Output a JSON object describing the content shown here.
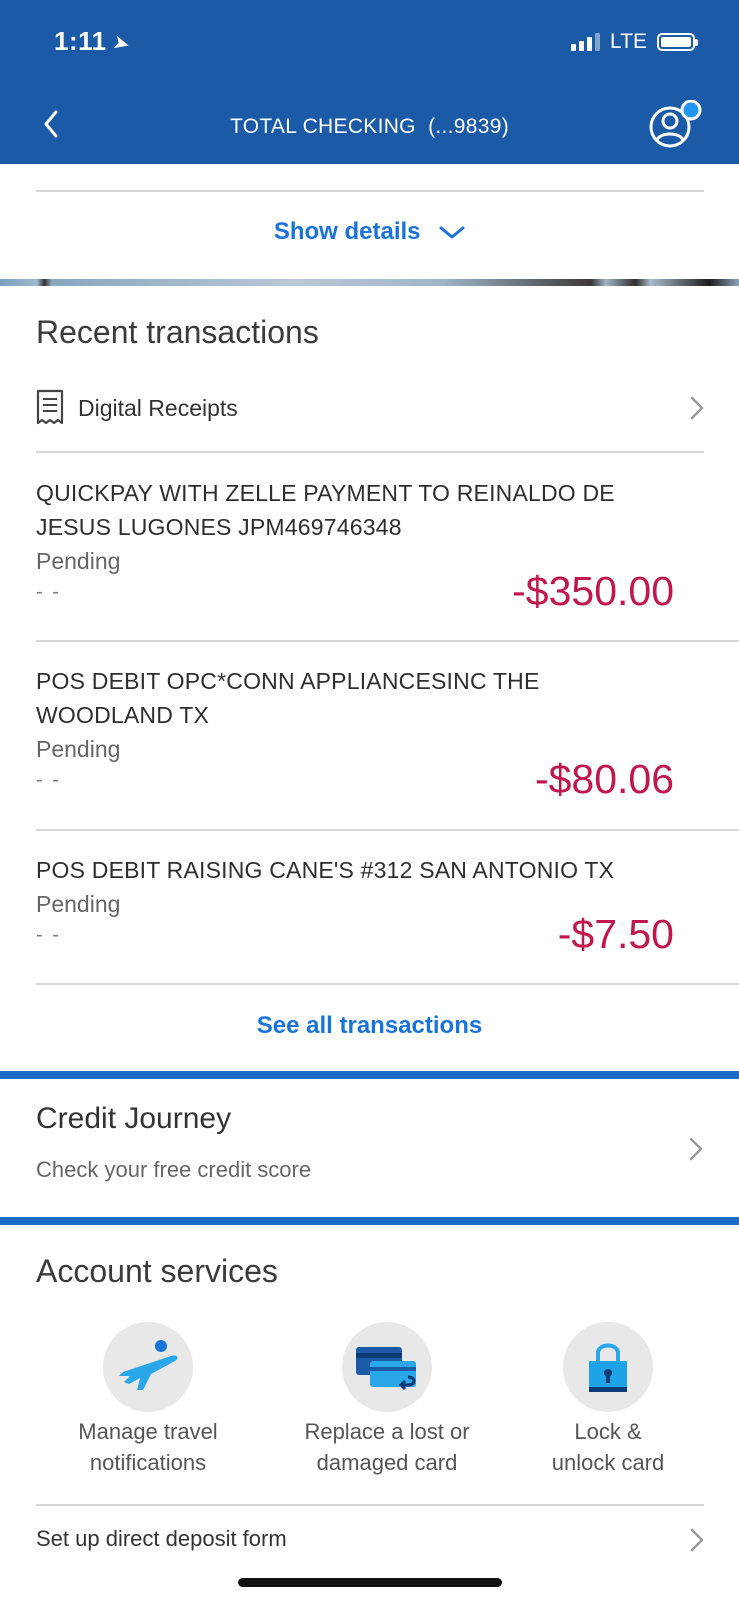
{
  "status_bar": {
    "time": "1:11",
    "network": "LTE"
  },
  "nav": {
    "title": "TOTAL CHECKING  (...9839)"
  },
  "details": {
    "show_details_label": "Show details"
  },
  "recent": {
    "title": "Recent transactions",
    "digital_receipts_label": "Digital Receipts",
    "transactions": [
      {
        "description": "QUICKPAY WITH ZELLE PAYMENT TO REINALDO DE JESUS LUGONES JPM469746348",
        "status": "Pending",
        "date": "- -",
        "amount": "-$350.00"
      },
      {
        "description": "POS DEBIT OPC*CONN APPLIANCESINC THE WOODLAND TX",
        "status": "Pending",
        "date": "- -",
        "amount": "-$80.06"
      },
      {
        "description": "POS DEBIT RAISING CANE'S #312 SAN ANTONIO TX",
        "status": "Pending",
        "date": "- -",
        "amount": "-$7.50"
      }
    ],
    "see_all_label": "See all transactions"
  },
  "credit_journey": {
    "title": "Credit Journey",
    "subtitle": "Check your free credit score"
  },
  "account_services": {
    "title": "Account services",
    "items": [
      {
        "label_line1": "Manage travel",
        "label_line2": "notifications",
        "icon": "airplane-icon"
      },
      {
        "label_line1": "Replace a lost or",
        "label_line2": "damaged card",
        "icon": "replace-card-icon"
      },
      {
        "label_line1": "Lock &",
        "label_line2": "unlock card",
        "icon": "lock-icon"
      }
    ],
    "direct_deposit_label": "Set up direct deposit form"
  },
  "colors": {
    "header_blue": "#1a5aa6",
    "link_blue": "#1a73d9",
    "amount_red": "#c0184e"
  }
}
